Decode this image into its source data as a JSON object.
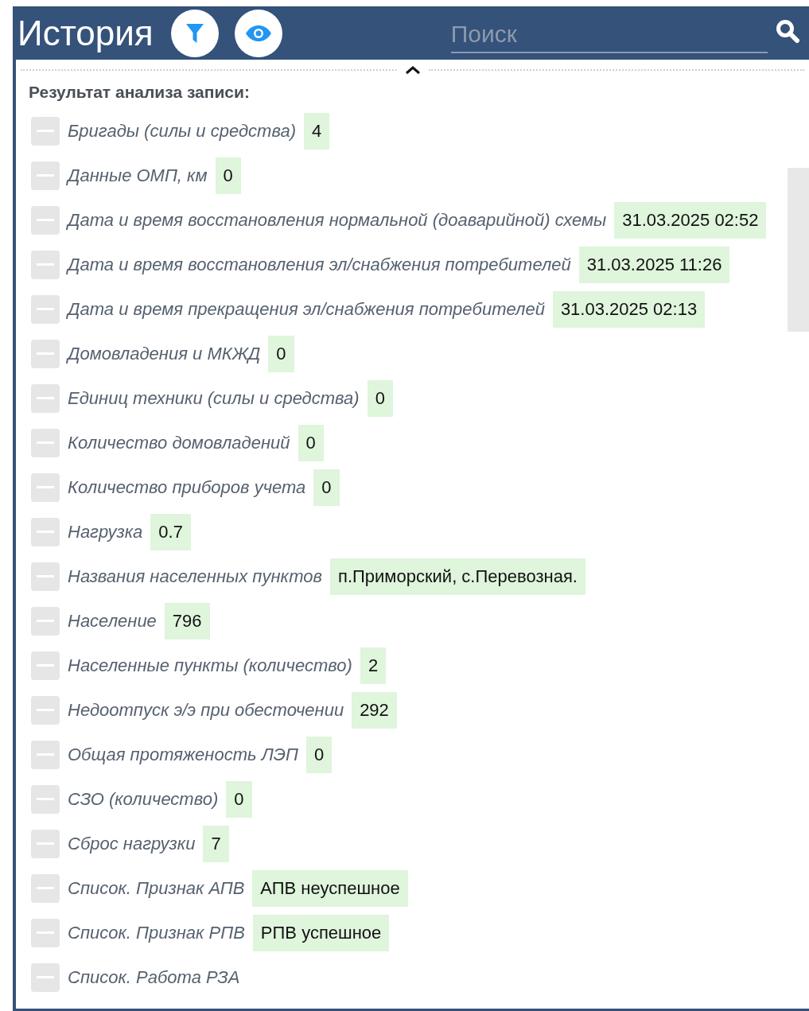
{
  "header": {
    "title": "История",
    "search": {
      "placeholder": "Поиск"
    }
  },
  "section_title": "Результат анализа записи:",
  "rows": [
    {
      "label": "Бригады (силы и средства)",
      "value": "4"
    },
    {
      "label": "Данные ОМП, км",
      "value": "0"
    },
    {
      "label": "Дата и время восстановления нормальной (доаварийной) схемы",
      "value": "31.03.2025 02:52"
    },
    {
      "label": "Дата и время восстановления эл/снабжения потребителей",
      "value": "31.03.2025 11:26"
    },
    {
      "label": "Дата и время прекращения эл/снабжения потребителей",
      "value": "31.03.2025 02:13"
    },
    {
      "label": "Домовладения и МКЖД",
      "value": "0"
    },
    {
      "label": "Единиц техники (силы и средства)",
      "value": "0"
    },
    {
      "label": "Количество домовладений",
      "value": "0"
    },
    {
      "label": "Количество приборов учета",
      "value": "0"
    },
    {
      "label": "Нагрузка",
      "value": "0.7"
    },
    {
      "label": "Названия населенных пунктов",
      "value": "п.Приморский, с.Перевозная."
    },
    {
      "label": "Население",
      "value": "796"
    },
    {
      "label": "Населенные пункты (количество)",
      "value": "2"
    },
    {
      "label": "Недоотпуск э/э при обесточении",
      "value": "292"
    },
    {
      "label": "Общая протяженость ЛЭП",
      "value": "0"
    },
    {
      "label": "СЗО (количество)",
      "value": "0"
    },
    {
      "label": "Сброс нагрузки",
      "value": "7"
    },
    {
      "label": "Список. Признак АПВ",
      "value": "АПВ неуспешное"
    },
    {
      "label": "Список. Признак РПВ",
      "value": "РПВ успешное"
    },
    {
      "label": "Список. Работа РЗА"
    }
  ]
}
